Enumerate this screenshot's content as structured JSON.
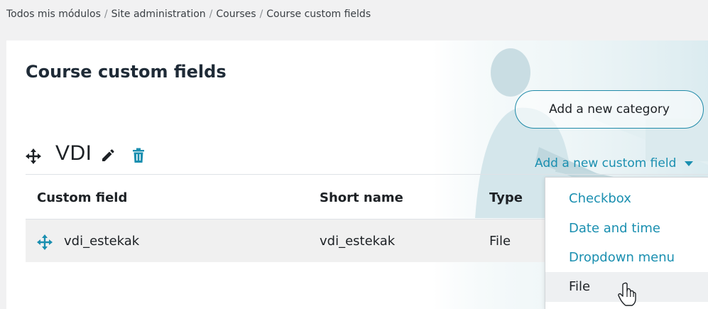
{
  "breadcrumb": {
    "items": [
      "Todos mis módulos",
      "Site administration",
      "Courses",
      "Course custom fields"
    ],
    "separator": "/"
  },
  "page": {
    "title": "Course custom fields",
    "add_category_label": "Add a new category"
  },
  "category": {
    "name": "VDI",
    "add_field_label": "Add a new custom field"
  },
  "table": {
    "headers": [
      "Custom field",
      "Short name",
      "Type"
    ],
    "rows": [
      {
        "name": "vdi_estekak",
        "shortname": "vdi_estekak",
        "type": "File"
      }
    ]
  },
  "dropdown": {
    "items": [
      "Checkbox",
      "Date and time",
      "Dropdown menu",
      "File"
    ],
    "hovered": "File"
  },
  "icons": {
    "move": "move-arrows-icon",
    "edit": "pencil-icon",
    "delete": "trash-icon",
    "caret": "caret-down-icon",
    "cursor": "hand-pointer-icon"
  },
  "colors": {
    "link": "#1a8fb0",
    "button_border": "#1f8aa8",
    "row_bg": "#f0f0f0",
    "page_bg": "#f1f1f2"
  }
}
